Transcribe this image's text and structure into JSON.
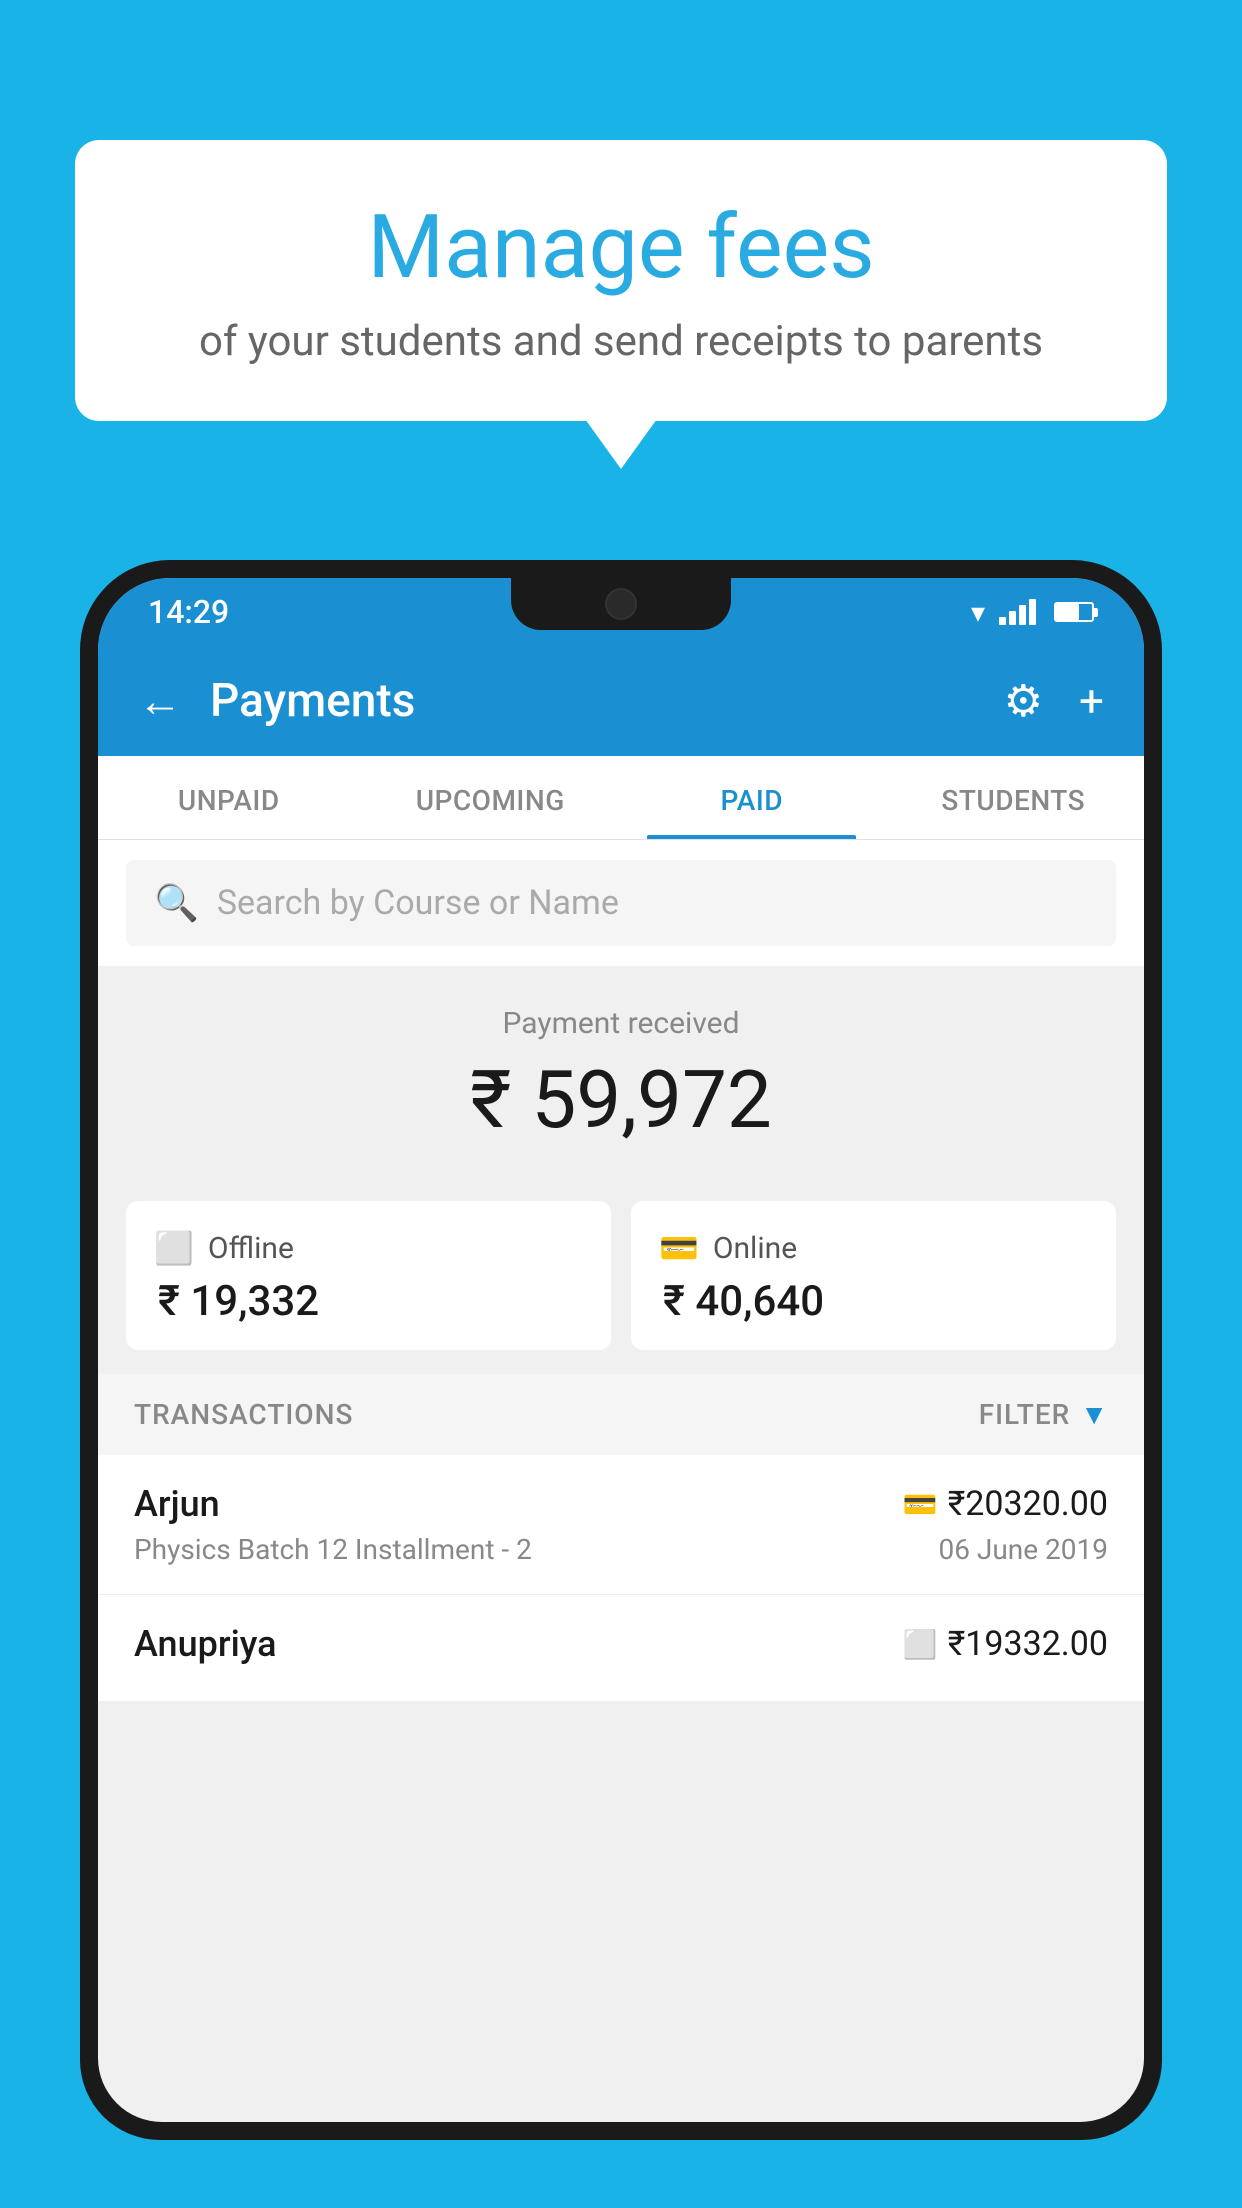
{
  "background_color": "#1ab3e8",
  "bubble": {
    "title": "Manage fees",
    "subtitle": "of your students and send receipts to parents"
  },
  "status_bar": {
    "time": "14:29"
  },
  "header": {
    "title": "Payments",
    "back_label": "←",
    "gear_label": "⚙",
    "plus_label": "+"
  },
  "tabs": [
    {
      "label": "UNPAID",
      "active": false
    },
    {
      "label": "UPCOMING",
      "active": false
    },
    {
      "label": "PAID",
      "active": true
    },
    {
      "label": "STUDENTS",
      "active": false
    }
  ],
  "search": {
    "placeholder": "Search by Course or Name"
  },
  "payment_received": {
    "label": "Payment received",
    "amount": "₹ 59,972"
  },
  "payment_cards": {
    "offline": {
      "type": "Offline",
      "amount": "₹ 19,332"
    },
    "online": {
      "type": "Online",
      "amount": "₹ 40,640"
    }
  },
  "transactions": {
    "header_label": "TRANSACTIONS",
    "filter_label": "FILTER",
    "rows": [
      {
        "name": "Arjun",
        "course": "Physics Batch 12 Installment - 2",
        "amount": "₹20320.00",
        "date": "06 June 2019",
        "payment_type": "card"
      },
      {
        "name": "Anupriya",
        "course": "",
        "amount": "₹19332.00",
        "date": "",
        "payment_type": "offline"
      }
    ]
  }
}
